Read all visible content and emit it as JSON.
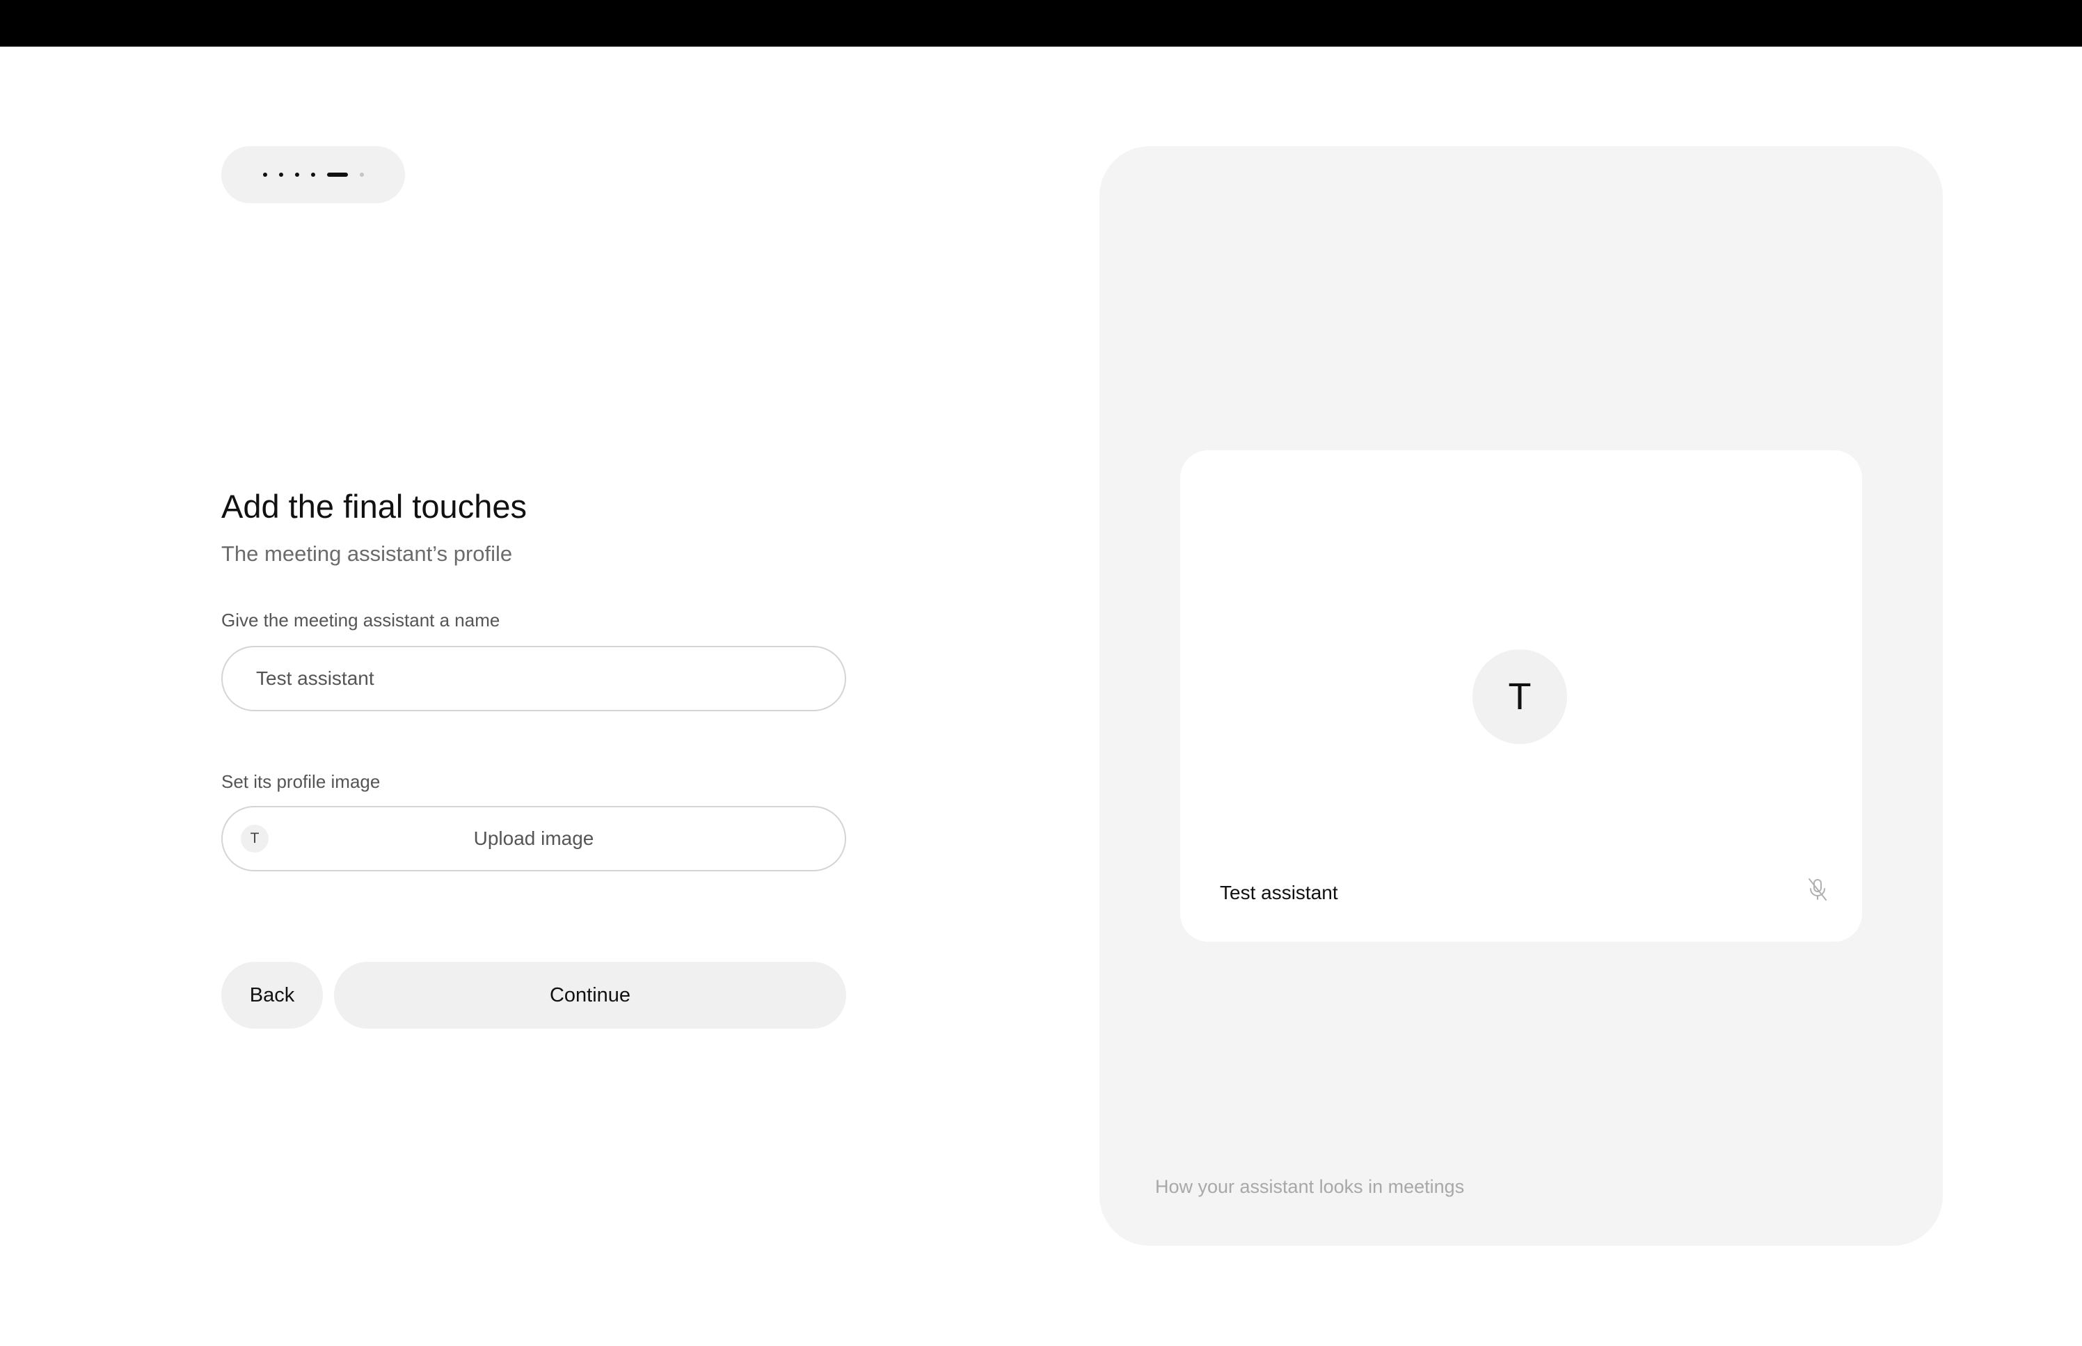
{
  "stepper": {
    "total_steps": 6,
    "current_step": 5
  },
  "form": {
    "title": "Add the final touches",
    "subtitle": "The meeting assistant’s profile",
    "name_label": "Give the meeting assistant a name",
    "name_value": "Test assistant",
    "image_label": "Set its profile image",
    "image_avatar_initial": "T",
    "upload_label": "Upload image",
    "back_label": "Back",
    "continue_label": "Continue"
  },
  "preview": {
    "avatar_initial": "T",
    "name": "Test assistant",
    "mic_icon": "mic-off-icon",
    "caption": "How your assistant looks in meetings"
  },
  "colors": {
    "background": "#ffffff",
    "topbar": "#000000",
    "pill_bg": "#f0f0f0",
    "panel_bg": "#f4f4f4",
    "text_primary": "#111111",
    "text_secondary": "#6b6b6b",
    "text_muted": "#a8a8a8"
  }
}
